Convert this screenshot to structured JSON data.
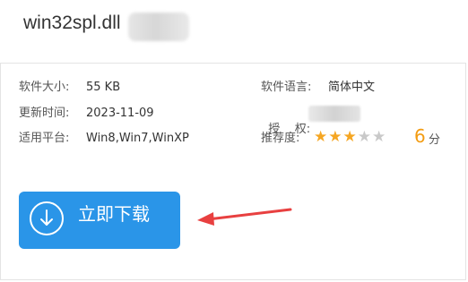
{
  "header": {
    "file_name": "win32spl.dll"
  },
  "info": {
    "size_label": "软件大小:",
    "size_value": "55 KB",
    "updated_label": "更新时间:",
    "updated_value": "2023-11-09",
    "platform_label": "适用平台:",
    "platform_value": "Win8,Win7,WinXP",
    "language_label": "软件语言:",
    "language_value": "简体中文",
    "license_label": "授    权:",
    "rating_label": "推荐度:",
    "rating_stars": 3,
    "rating_max": 5,
    "rating_score": "6",
    "rating_unit": "分"
  },
  "download": {
    "label": "立即下载",
    "icon": "download-arrow-icon"
  },
  "colors": {
    "button": "#2a95e8",
    "star": "#f5a623",
    "score": "#f39c12",
    "arrow": "#e84040"
  }
}
